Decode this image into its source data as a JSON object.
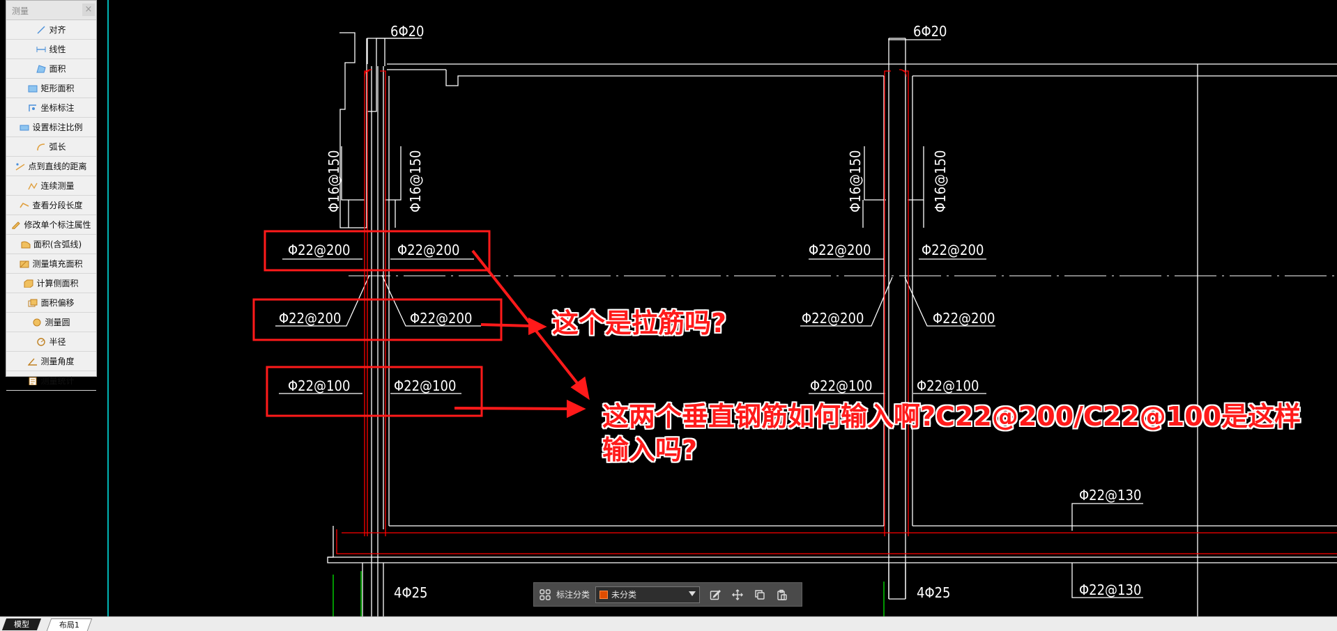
{
  "measure_panel": {
    "title": "测量",
    "close_symbol": "×",
    "tools": [
      {
        "label": "对齐",
        "icon": "align-dimension-icon"
      },
      {
        "label": "线性",
        "icon": "linear-dimension-icon"
      },
      {
        "label": "面积",
        "icon": "area-icon"
      },
      {
        "label": "矩形面积",
        "icon": "rectangle-area-icon"
      },
      {
        "label": "坐标标注",
        "icon": "coordinate-icon"
      },
      {
        "label": "设置标注比例",
        "icon": "scale-icon"
      },
      {
        "label": "弧长",
        "icon": "arc-length-icon"
      },
      {
        "label": "点到直线的距离",
        "icon": "point-to-line-icon"
      },
      {
        "label": "连续测量",
        "icon": "continuous-measure-icon"
      },
      {
        "label": "查看分段长度",
        "icon": "segment-length-icon"
      },
      {
        "label": "修改单个标注属性",
        "icon": "edit-dimension-icon"
      },
      {
        "label": "面积(含弧线)",
        "icon": "arc-area-icon"
      },
      {
        "label": "测量填充面积",
        "icon": "hatch-area-icon"
      },
      {
        "label": "计算侧面积",
        "icon": "side-area-icon"
      },
      {
        "label": "面积偏移",
        "icon": "area-offset-icon"
      },
      {
        "label": "测量圆",
        "icon": "circle-measure-icon"
      },
      {
        "label": "半径",
        "icon": "radius-icon"
      },
      {
        "label": "测量角度",
        "icon": "angle-icon"
      },
      {
        "label": "测量统计",
        "icon": "statistics-icon"
      }
    ]
  },
  "drawing_labels": {
    "top_left_bar": "6Φ20",
    "top_right_bar": "6Φ20",
    "stirrup_1": "Φ16@150",
    "stirrup_2": "Φ16@150",
    "stirrup_3": "Φ16@150",
    "stirrup_4": "Φ16@150",
    "left_r1_a": "Φ22@200",
    "left_r1_b": "Φ22@200",
    "left_r2_a": "Φ22@200",
    "left_r2_b": "Φ22@200",
    "left_r3_a": "Φ22@100",
    "left_r3_b": "Φ22@100",
    "right_r1_a": "Φ22@200",
    "right_r1_b": "Φ22@200",
    "right_r2_a": "Φ22@200",
    "right_r2_b": "Φ22@200",
    "right_r3_a": "Φ22@100",
    "right_r3_b": "Φ22@100",
    "slab_top": "Φ22@130",
    "slab_bottom": "Φ22@130",
    "bottom_left_bar": "4Φ25",
    "bottom_right_bar": "4Φ25"
  },
  "annotations": {
    "question_1": "这个是拉筋吗?",
    "question_2_line1": "这两个垂直钢筋如何输入啊?C22@200/C22@100是这样",
    "question_2_line2": "输入吗?"
  },
  "annotation_toolbar": {
    "category_label": "标注分类",
    "category_value": "未分类",
    "category_color": "#e04d00"
  },
  "tabs": {
    "model": "模型",
    "layout": "布局1"
  },
  "colors": {
    "cad_background": "#000000",
    "cad_lines": "#ffffff",
    "cad_red": "#ff0000",
    "cad_green": "#00c800",
    "cad_cyan": "#00b4b4",
    "annotation_red": "#ff1a1a"
  }
}
